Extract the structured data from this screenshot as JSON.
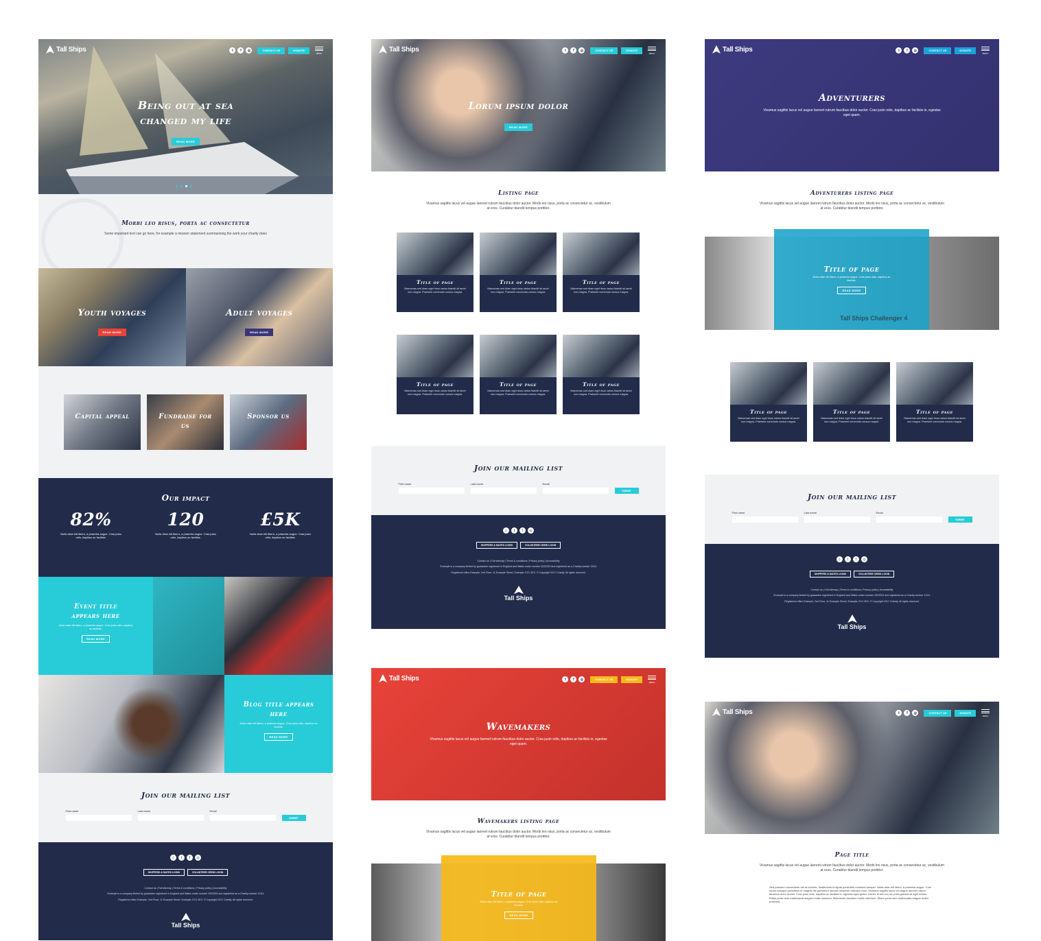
{
  "brand": {
    "name": "Tall Ships",
    "colors": {
      "navy": "#222c4a",
      "teal": "#28cbd8",
      "red": "#e8433a",
      "purple": "#3a3578",
      "yellow": "#f6b81a"
    }
  },
  "nav": {
    "contact_label": "CONTACT US",
    "donate_label": "DONATE",
    "menu_label": "MENU",
    "social_icons": [
      "twitter-icon",
      "facebook-icon",
      "instagram-icon"
    ]
  },
  "home": {
    "hero_title": "Being out at sea changed my life",
    "hero_button": "READ MORE",
    "mission_title": "Morbi leo risus, porta ac consectetur",
    "mission_text": "Some important text can go here, for example a mission statement summarising the work your charity does",
    "voyages": [
      {
        "title": "Youth voyages",
        "button": "READ MORE"
      },
      {
        "title": "Adult voyages",
        "button": "READ MORE"
      }
    ],
    "tiles": [
      "Capital appeal",
      "Fundraise for us",
      "Sponsor us"
    ],
    "impact_title": "Our impact",
    "stats": [
      {
        "value": "82%",
        "text": "Nulla vitae elit libero, a pharetra augue. Cras justo odio, dapibus ac facilisis."
      },
      {
        "value": "120",
        "text": "Nulla vitae elit libero, a pharetra augue. Cras justo odio, dapibus ac facilisis."
      },
      {
        "value": "£5K",
        "text": "Nulla vitae elit libero, a pharetra augue. Cras justo odio, dapibus ac facilisis."
      }
    ],
    "event": {
      "title": "Event title appears here",
      "text": "Nulla vitae elit libero, a pharetra augue. Cras justo odio, dapibus ac facilisis.",
      "button": "READ MORE"
    },
    "blog": {
      "title": "Blog title appears here",
      "text": "Nulla vitae elit libero, a pharetra augue. Cras justo odio, dapibus ac facilisis.",
      "button": "READ MORE"
    }
  },
  "mailing": {
    "title": "Join our mailing list",
    "first": "First name",
    "last": "Last name",
    "email": "Email",
    "submit": "SUBMIT"
  },
  "footer": {
    "skippers": "SKIPPERS & MATES LOGIN",
    "volunteer": "VOLUNTEER CREW LOGIN",
    "links": "Contact us | Full sitemap | Terms & conditions | Privacy policy | Accessibility",
    "company": "Example is a company limited by guarantee registered in England and Wales under number 3333333 and registered as a Charity number 11111",
    "office": "Registered office Example, 2nd Floor, 11 Example Street, Example, EX1 3EX. © Copyright 2017 Charity. All rights reserved.",
    "brand": "Tall Ships"
  },
  "listing": {
    "hero_title": "Lorum ipsum dolor",
    "hero_button": "READ MORE",
    "title": "Listing page",
    "intro": "Vivamus sagittis lacus vel augue laoreet rutrum faucibus dolor auctor. Morbi leo risus, porta ac consectetur ac, vestibulum at eros. Curabitur blandit tempus porttitor.",
    "card_title": "Title of page",
    "card_text": "Maecenas sed diam eget risus varius blandit sit amet non magna. Praesent commodo cursus magna."
  },
  "wavemakers": {
    "hero_title": "Wavemakers",
    "hero_text": "Vivamus sagittis lacus vel augue laoreet rutrum faucibus dolor auctor. Cras justo odio, dapibus ac facilisis in, egestas eget quam.",
    "title": "Wavemakers listing page",
    "intro": "Vivamus sagittis lacus vel augue laoreet rutrum faucibus dolor auctor. Morbi leo risus, porta ac consectetur ac, vestibulum at eros. Curabitur blandit tempus porttitor.",
    "feature_title": "Title of page",
    "feature_text": "Nulla vitae elit libero, a pharetra augue. Cras justo odio, dapibus ac facilisis.",
    "feature_button": "READ MORE"
  },
  "adventurers": {
    "hero_title": "Adventurers",
    "hero_text": "Vivamus sagittis lacus vel augue laoreet rutrum faucibus dolor auctor. Cras justo odio, dapibus ac facilisis in, egestas eget quam.",
    "title": "Adventurers listing page",
    "intro": "Vivamus sagittis lacus vel augue laoreet rutrum faucibus dolor auctor. Morbi leo risus, porta ac consectetur ac, vestibulum at eros. Curabitur blandit tempus porttitor.",
    "feature_title": "Title of page",
    "feature_text": "Nulla vitae elit libero, a pharetra augue. Cras justo odio, dapibus ac facilisis.",
    "feature_button": "READ MORE",
    "ship_name": "Tall Ships Challenger 4"
  },
  "page": {
    "title": "Page title",
    "intro": "Vivamus sagittis lacus vel augue laoreet rutrum faucibus dolor auctor. Morbi leo risus, porta ac consectetur ac, vestibulum at eros. Curabitur blandit tempus porttitor.",
    "body": "Sed posuere consectetur est at lobortis. Vestibulum id ligula porta felis euismod semper. Nulla vitae elit libero, a pharetra augue. Cum sociis natoque penatibus et magnis dis parturient montes nascetur ridiculus mus. Vivamus sagittis lacus vel augue laoreet rutrum faucibus dolor auctor. Cras justo odio, dapibus ac facilisis in, egestas eget quam. Donec id elit non mi porta gravida at eget metus. Etiam porta sem malesuada magna mollis euismod. Maecenas faucibus mollis interdum. Etiam porta sem malesuada magna mollis euismod."
  }
}
